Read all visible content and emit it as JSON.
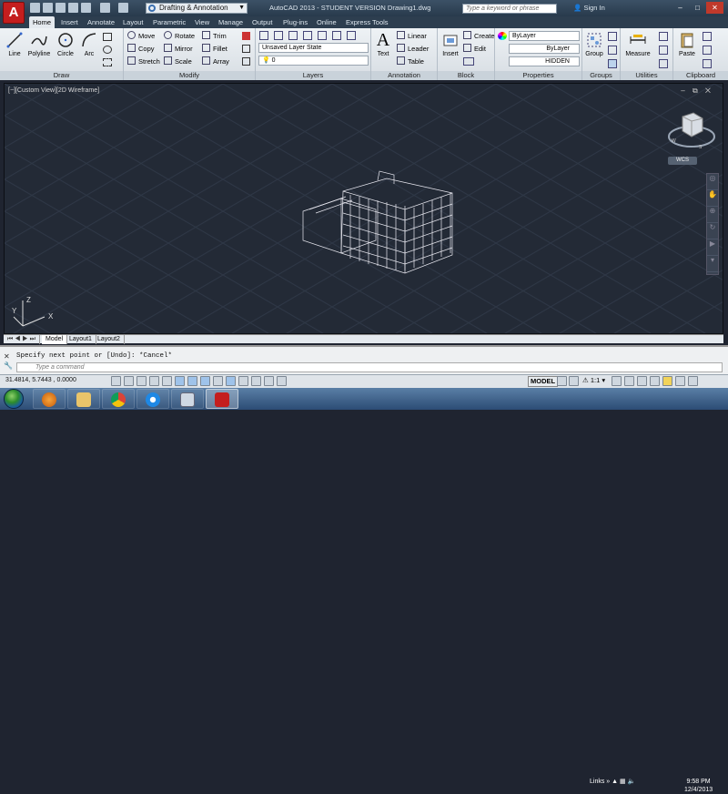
{
  "app": {
    "title": "AutoCAD 2013 - STUDENT VERSION    Drawing1.dwg",
    "workspace": "Drafting & Annotation",
    "search_placeholder": "Type a keyword or phrase",
    "signin": "Sign In",
    "logo_letter": "A"
  },
  "tabs": [
    "Home",
    "Insert",
    "Annotate",
    "Layout",
    "Parametric",
    "View",
    "Manage",
    "Output",
    "Plug-ins",
    "Online",
    "Express Tools"
  ],
  "ribbon": {
    "draw": {
      "title": "Draw",
      "line": "Line",
      "polyline": "Polyline",
      "circle": "Circle",
      "arc": "Arc"
    },
    "modify": {
      "title": "Modify",
      "move": "Move",
      "rotate": "Rotate",
      "trim": "Trim",
      "copy": "Copy",
      "mirror": "Mirror",
      "fillet": "Fillet",
      "stretch": "Stretch",
      "scale": "Scale",
      "array": "Array"
    },
    "layers": {
      "title": "Layers",
      "state": "Unsaved Layer State",
      "current": "0"
    },
    "annotation": {
      "title": "Annotation",
      "text": "Text",
      "linear": "Linear",
      "leader": "Leader",
      "table": "Table"
    },
    "block": {
      "title": "Block",
      "insert": "Insert",
      "create": "Create",
      "edit": "Edit"
    },
    "properties": {
      "title": "Properties",
      "color": "ByLayer",
      "lineweight": "ByLayer",
      "linetype": "HIDDEN"
    },
    "groups": {
      "title": "Groups",
      "group": "Group"
    },
    "utilities": {
      "title": "Utilities",
      "measure": "Measure"
    },
    "clipboard": {
      "title": "Clipboard",
      "paste": "Paste"
    }
  },
  "viewport": {
    "label": "[−][Custom View][2D Wireframe]",
    "wcs": "WCS",
    "axis_x": "X",
    "axis_y": "Y",
    "axis_z": "Z"
  },
  "layout_tabs": [
    "Model",
    "Layout1",
    "Layout2"
  ],
  "command": {
    "history": "Specify next point or [Undo]: *Cancel*",
    "placeholder": "Type a command"
  },
  "status": {
    "coords": "31.4814, 5.7443 , 0.0000",
    "model": "MODEL",
    "scale": "1:1"
  },
  "taskbar": {
    "tray_links": "Links",
    "time": "9:58 PM",
    "date": "12/4/2013"
  }
}
